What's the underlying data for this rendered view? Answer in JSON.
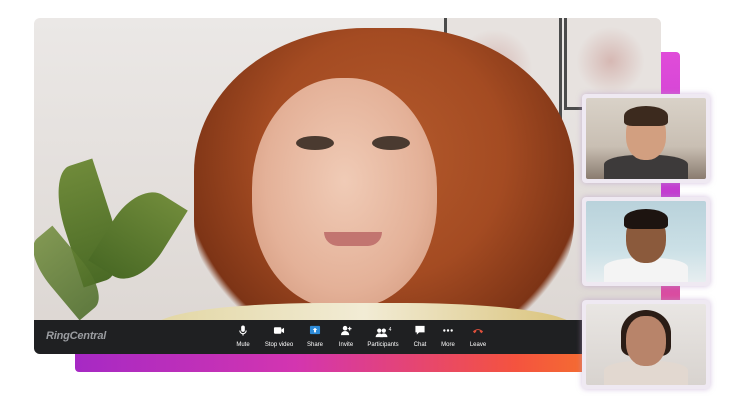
{
  "brand": "RingCentral",
  "controls": [
    {
      "label": "Mute",
      "icon": "microphone-icon"
    },
    {
      "label": "Stop video",
      "icon": "video-camera-icon"
    },
    {
      "label": "Share",
      "icon": "share-screen-icon"
    },
    {
      "label": "Invite",
      "icon": "add-person-icon"
    },
    {
      "label": "Participants",
      "icon": "participants-icon",
      "badge": "4"
    },
    {
      "label": "Chat",
      "icon": "chat-bubble-icon"
    },
    {
      "label": "More",
      "icon": "more-dots-icon"
    },
    {
      "label": "Leave",
      "icon": "leave-phone-icon"
    }
  ],
  "colors": {
    "toolbar_bg": "#1f2022",
    "share_accent": "#2e8bd8",
    "leave_red": "#e0503c",
    "gradient_start": "#a629c4",
    "gradient_end": "#f57a2a"
  }
}
